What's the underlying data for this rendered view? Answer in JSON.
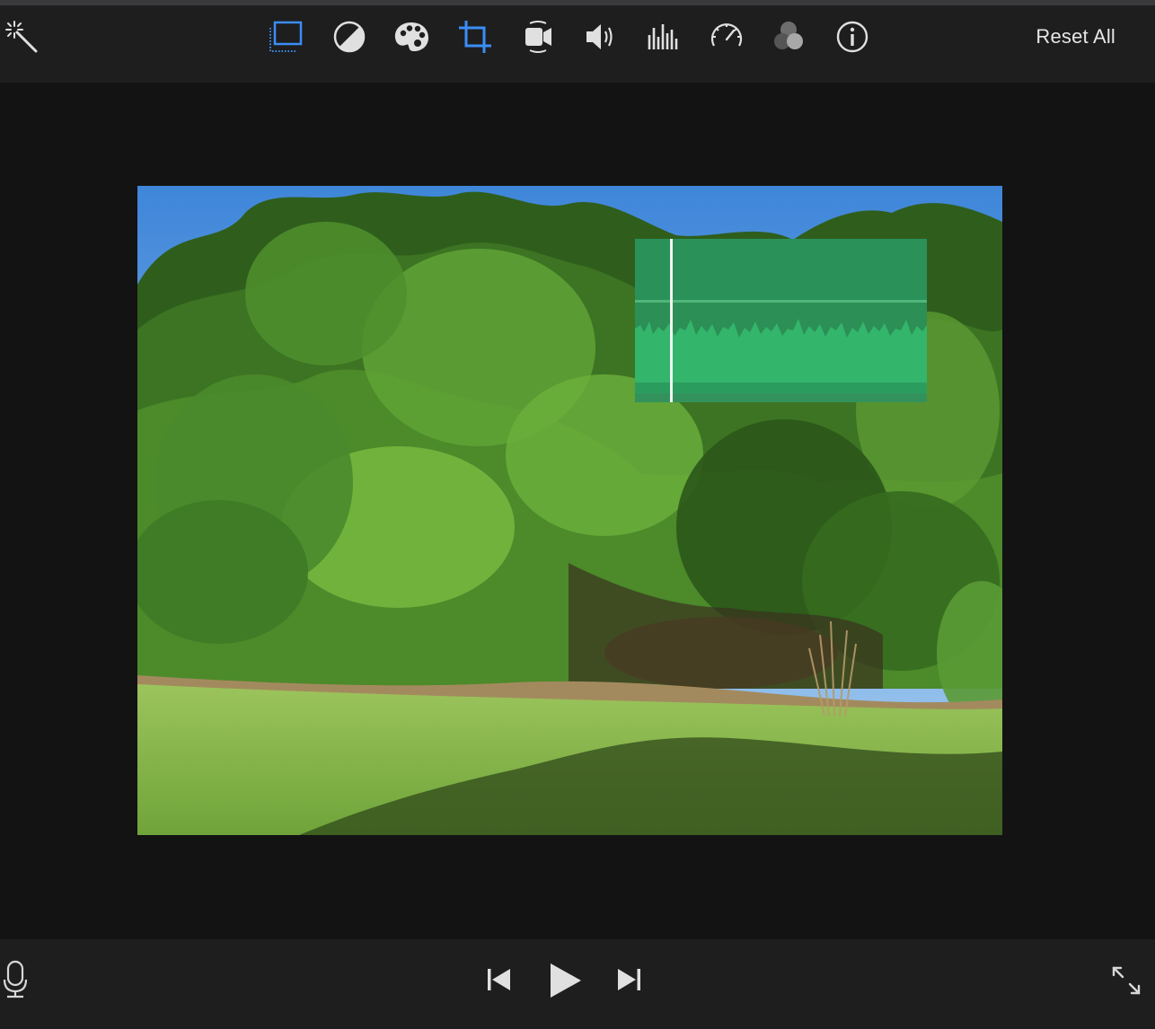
{
  "toolbar": {
    "tools": [
      {
        "name": "magic-wand-icon",
        "active": false
      },
      {
        "name": "video-overlay-icon",
        "active": true
      },
      {
        "name": "color-balance-icon",
        "active": false
      },
      {
        "name": "color-correction-icon",
        "active": false
      },
      {
        "name": "crop-icon",
        "active": true
      },
      {
        "name": "stabilization-icon",
        "active": false
      },
      {
        "name": "volume-icon",
        "active": false
      },
      {
        "name": "noise-equalizer-icon",
        "active": false
      },
      {
        "name": "speed-icon",
        "active": false
      },
      {
        "name": "clip-filter-icon",
        "active": false
      },
      {
        "name": "info-icon",
        "active": false
      }
    ],
    "reset_label": "Reset All"
  },
  "viewer": {
    "overlay_type": "audio-waveform",
    "overlay_color": "#2e9358",
    "playhead_position": 0.12
  },
  "controls": {
    "voiceover": "microphone-icon",
    "previous": "skip-back-icon",
    "play": "play-icon",
    "next": "skip-forward-icon",
    "fullscreen": "fullscreen-icon"
  },
  "colors": {
    "accent": "#3a8ef6",
    "toolbar_bg": "#1e1e1e",
    "viewer_bg": "#131313",
    "icon": "#e0e0e0"
  }
}
